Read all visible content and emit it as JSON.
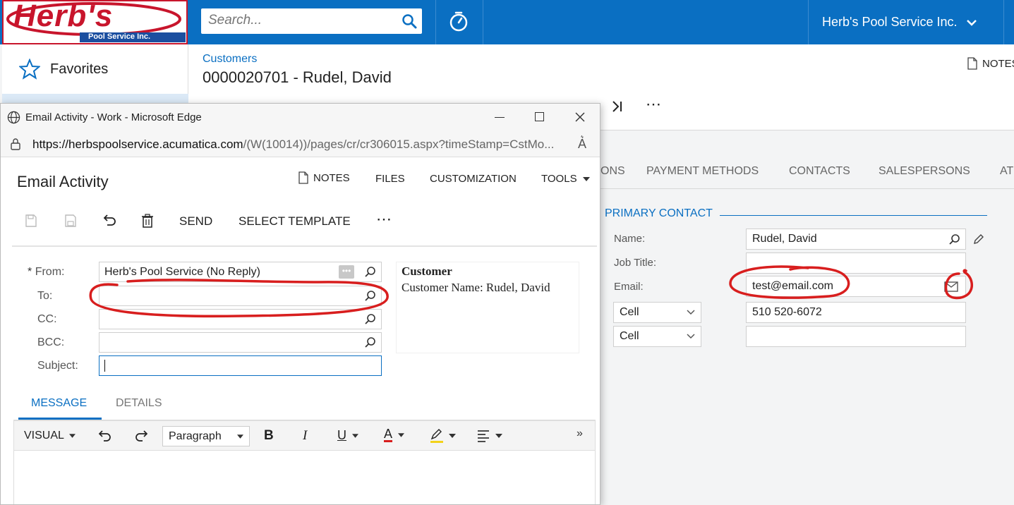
{
  "header": {
    "logo_text": "Herb's",
    "logo_sub": "Pool Service Inc.",
    "search_placeholder": "Search...",
    "company": "Herb's Pool Service Inc."
  },
  "sidebar": {
    "favorites": "Favorites"
  },
  "page": {
    "breadcrumb": "Customers",
    "title": "0000020701 - Rudel, David",
    "notes": "NOTES"
  },
  "tabs": [
    "ONS",
    "PAYMENT METHODS",
    "CONTACTS",
    "SALESPERSONS",
    "AT"
  ],
  "primary_contact": {
    "heading": "PRIMARY CONTACT",
    "name_label": "Name:",
    "name_value": "Rudel, David",
    "job_label": "Job Title:",
    "email_label": "Email:",
    "email_value": "test@email.com",
    "phone1_type": "Cell",
    "phone1_value": "510 520-6072",
    "phone2_type": "Cell"
  },
  "popup": {
    "window_title": "Email Activity - Work - Microsoft Edge",
    "url_host": "https://herbspoolservice.acumatica.com",
    "url_path": "/(W(10014))/pages/cr/cr306015.aspx?timeStamp=CstMo...",
    "form_title": "Email Activity",
    "menu": {
      "notes": "NOTES",
      "files": "FILES",
      "customization": "CUSTOMIZATION",
      "tools": "TOOLS"
    },
    "toolbar": {
      "send": "SEND",
      "select_template": "SELECT TEMPLATE"
    },
    "from_label": "From:",
    "from_value": "Herb's Pool Service (No Reply)",
    "to_label": "To:",
    "cc_label": "CC:",
    "bcc_label": "BCC:",
    "subject_label": "Subject:",
    "preview_title": "Customer",
    "preview_line": "Customer Name: Rudel, David",
    "tab_message": "MESSAGE",
    "tab_details": "DETAILS",
    "editor_mode": "VISUAL",
    "paragraph": "Paragraph"
  },
  "colors": {
    "topbar": "#0a6fc2",
    "accent": "#0a6fc2",
    "annotation": "#d81e1e"
  }
}
